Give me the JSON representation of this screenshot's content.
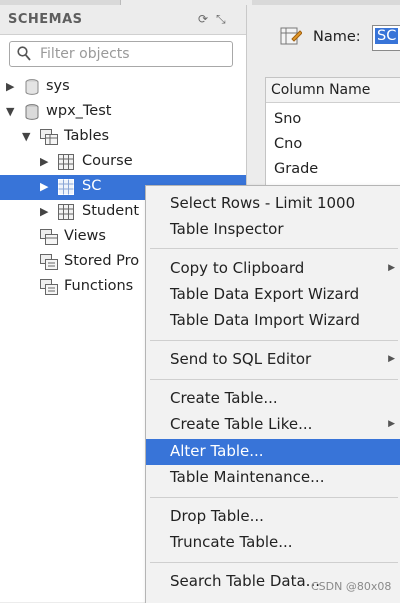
{
  "schemas": {
    "title": "SCHEMAS",
    "filter_placeholder": "Filter objects"
  },
  "tree": {
    "sys": "sys",
    "wpx_test": "wpx_Test",
    "tables": "Tables",
    "course": "Course",
    "sc": "SC",
    "student": "Student",
    "views": "Views",
    "stored_procedures": "Stored Pro",
    "functions": "Functions"
  },
  "editor": {
    "name_label": "Name:",
    "name_value": "SC",
    "column_header": "Column Name",
    "columns": [
      "Sno",
      "Cno",
      "Grade"
    ]
  },
  "context_menu": {
    "items": [
      {
        "label": "Select Rows - Limit 1000"
      },
      {
        "label": "Table Inspector"
      },
      {
        "label": "Copy to Clipboard",
        "submenu": true
      },
      {
        "label": "Table Data Export Wizard"
      },
      {
        "label": "Table Data Import Wizard"
      },
      {
        "label": "Send to SQL Editor",
        "submenu": true
      },
      {
        "label": "Create Table..."
      },
      {
        "label": "Create Table Like...",
        "submenu": true
      },
      {
        "label": "Alter Table...",
        "highlighted": true
      },
      {
        "label": "Table Maintenance..."
      },
      {
        "label": "Drop Table..."
      },
      {
        "label": "Truncate Table..."
      },
      {
        "label": "Search Table Data..."
      }
    ]
  },
  "watermark": "CSDN @80x08",
  "colors": {
    "selection": "#3874d8",
    "menu_background": "#f2f2f2",
    "panel_background": "#ececec"
  }
}
